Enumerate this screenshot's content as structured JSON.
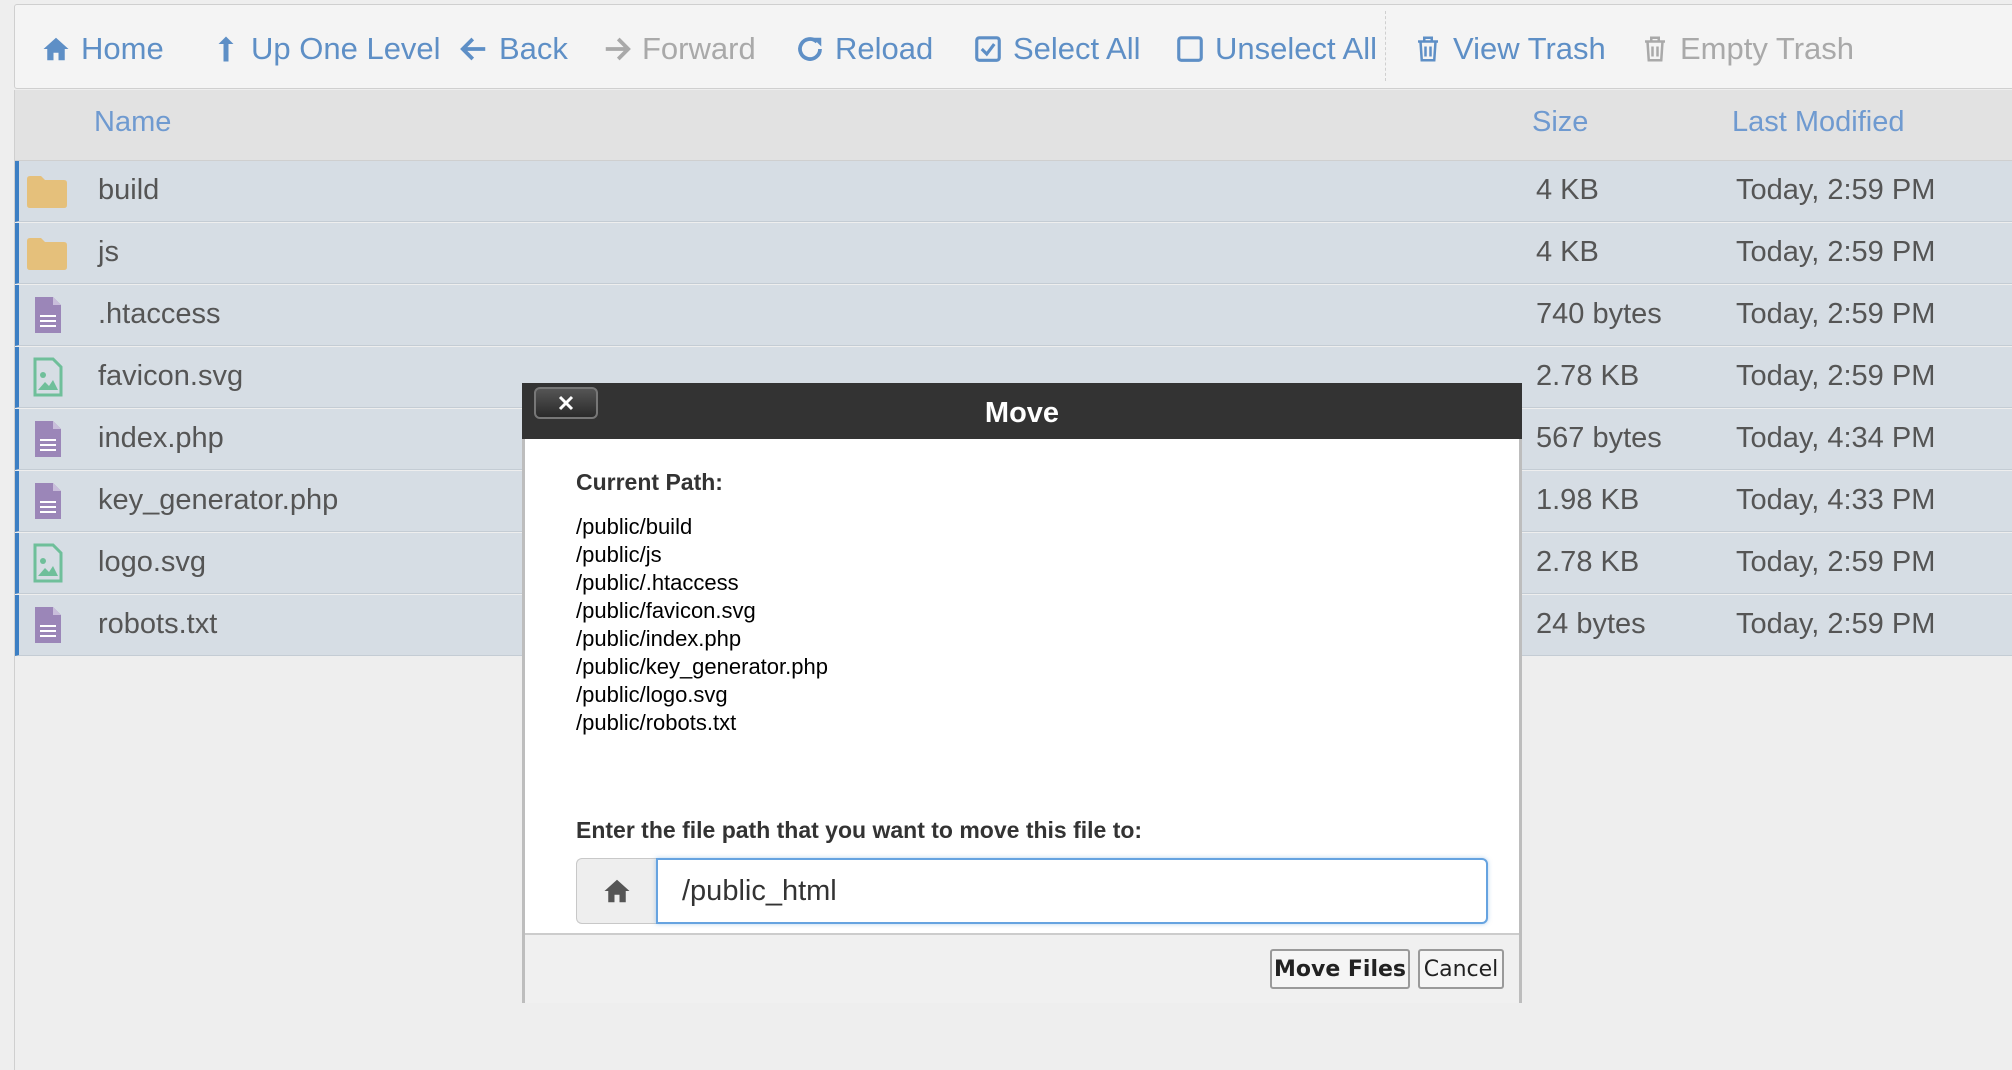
{
  "toolbar": {
    "items": [
      {
        "label": "Home",
        "icon": "home-icon"
      },
      {
        "label": "Up One Level",
        "icon": "level-up-icon"
      },
      {
        "label": "Back",
        "icon": "arrow-left-icon"
      },
      {
        "label": "Forward",
        "icon": "arrow-right-icon",
        "disabled": true
      },
      {
        "label": "Reload",
        "icon": "reload-icon"
      },
      {
        "label": "Select All",
        "icon": "checked-box-icon"
      },
      {
        "label": "Unselect All",
        "icon": "empty-box-icon"
      },
      {
        "label": "View Trash",
        "icon": "trash-icon"
      },
      {
        "label": "Empty Trash",
        "icon": "trash-icon",
        "disabled": true
      }
    ]
  },
  "columns": {
    "name": "Name",
    "size": "Size",
    "modified": "Last Modified"
  },
  "files": [
    {
      "name": "build",
      "size": "4 KB",
      "modified": "Today, 2:59 PM",
      "type": "folder"
    },
    {
      "name": "js",
      "size": "4 KB",
      "modified": "Today, 2:59 PM",
      "type": "folder"
    },
    {
      "name": ".htaccess",
      "size": "740 bytes",
      "modified": "Today, 2:59 PM",
      "type": "text"
    },
    {
      "name": "favicon.svg",
      "size": "2.78 KB",
      "modified": "Today, 2:59 PM",
      "type": "image"
    },
    {
      "name": "index.php",
      "size": "567 bytes",
      "modified": "Today, 4:34 PM",
      "type": "text"
    },
    {
      "name": "key_generator.php",
      "size": "1.98 KB",
      "modified": "Today, 4:33 PM",
      "type": "text"
    },
    {
      "name": "logo.svg",
      "size": "2.78 KB",
      "modified": "Today, 2:59 PM",
      "type": "image"
    },
    {
      "name": "robots.txt",
      "size": "24 bytes",
      "modified": "Today, 2:59 PM",
      "type": "text"
    }
  ],
  "modal": {
    "title": "Move",
    "close_label": "×",
    "current_path_label": "Current Path:",
    "paths": [
      "/public/build",
      "/public/js",
      "/public/.htaccess",
      "/public/favicon.svg",
      "/public/index.php",
      "/public/key_generator.php",
      "/public/logo.svg",
      "/public/robots.txt"
    ],
    "prompt": "Enter the file path that you want to move this file to:",
    "input_value": "/public_html",
    "move_button": "Move Files",
    "cancel_button": "Cancel"
  },
  "colors": {
    "accent": "#5e8fc6",
    "selected_row": "#d6dde4",
    "folder": "#e5c07b",
    "text_file": "#9b86b8",
    "image_file": "#6fbf9a",
    "title_bar": "#333333"
  }
}
